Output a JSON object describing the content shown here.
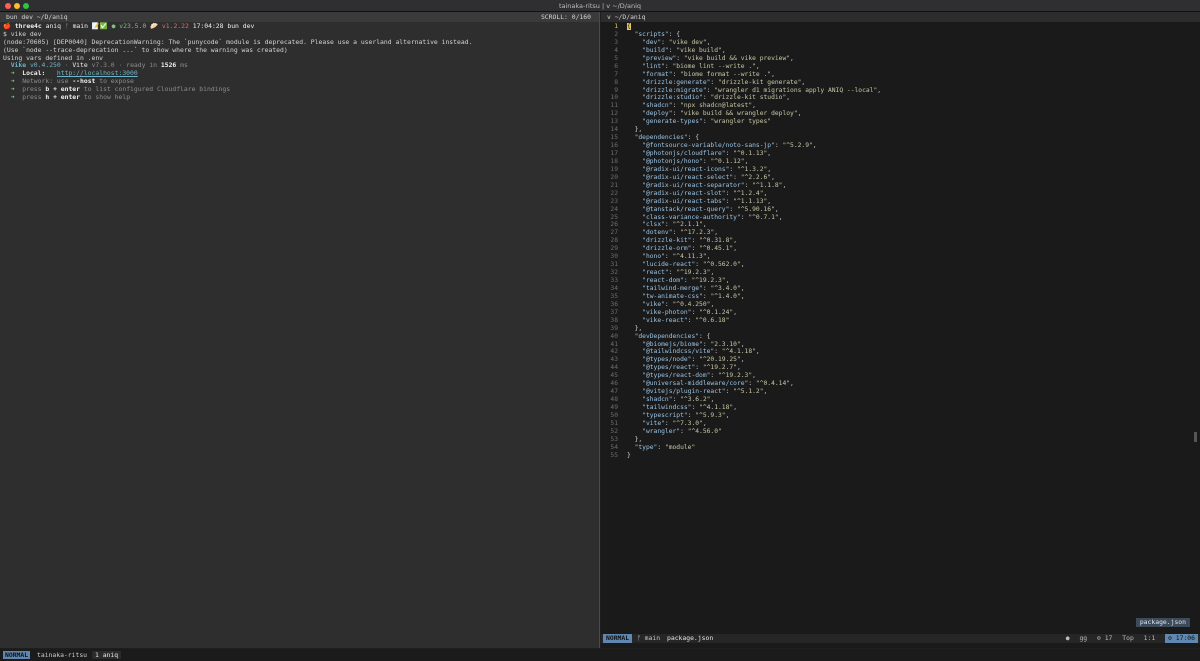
{
  "window": {
    "title": "tainaka-ritsu | v ~/D/aniq"
  },
  "left_pane": {
    "header_title": "bun dev ~/D/aniq",
    "scroll_label": "SCROLL:",
    "scroll_value": "0/160",
    "prompt": {
      "user": "three4c",
      "dir": "aniq",
      "branch": "main",
      "status_marks": "📝✅",
      "node_version": "● v23.5.0",
      "bun_version": "v1.2.22",
      "time": "17:04:28",
      "command": "bun dev"
    },
    "lines": [
      "$ vike dev",
      "(node:70605) [DEP0040] DeprecationWarning: The `punycode` module is deprecated. Please use a userland alternative instead.",
      "(Use `node --trace-deprecation ...` to show where the warning was created)",
      "Using vars defined in .env"
    ],
    "vike": {
      "name": "Vike",
      "version": "v0.4.250",
      "sep": "·",
      "vite": "Vite",
      "vite_version": "v7.3.0",
      "ready_text": "ready in",
      "ready_ms": "1526",
      "ready_unit": "ms"
    },
    "local_label": "Local:",
    "local_url": "http://localhost:3000",
    "network_label": "Network:",
    "network_text1": "use",
    "network_flag": "--host",
    "network_text2": "to expose",
    "hint1_pre": "press",
    "hint1_key": "b + enter",
    "hint1_post": "to list configured Cloudflare bindings",
    "hint2_pre": "press",
    "hint2_key": "h + enter",
    "hint2_post": "to show help"
  },
  "right_pane": {
    "header_title": "v ~/D/aniq",
    "file_badge": "package.json",
    "code_lines": [
      [
        [
          "cursor",
          "{"
        ]
      ],
      [
        [
          "p",
          "  "
        ],
        [
          "k",
          "\"scripts\""
        ],
        [
          "p",
          ": {"
        ]
      ],
      [
        [
          "p",
          "    "
        ],
        [
          "k",
          "\"dev\""
        ],
        [
          "p",
          ": "
        ],
        [
          "s",
          "\"vike dev\""
        ],
        [
          "p",
          ","
        ]
      ],
      [
        [
          "p",
          "    "
        ],
        [
          "k",
          "\"build\""
        ],
        [
          "p",
          ": "
        ],
        [
          "s",
          "\"vike build\""
        ],
        [
          "p",
          ","
        ]
      ],
      [
        [
          "p",
          "    "
        ],
        [
          "k",
          "\"preview\""
        ],
        [
          "p",
          ": "
        ],
        [
          "s",
          "\"vike build && vike preview\""
        ],
        [
          "p",
          ","
        ]
      ],
      [
        [
          "p",
          "    "
        ],
        [
          "k",
          "\"lint\""
        ],
        [
          "p",
          ": "
        ],
        [
          "s",
          "\"biome lint --write .\""
        ],
        [
          "p",
          ","
        ]
      ],
      [
        [
          "p",
          "    "
        ],
        [
          "k",
          "\"format\""
        ],
        [
          "p",
          ": "
        ],
        [
          "s",
          "\"biome format --write .\""
        ],
        [
          "p",
          ","
        ]
      ],
      [
        [
          "p",
          "    "
        ],
        [
          "k",
          "\"drizzle:generate\""
        ],
        [
          "p",
          ": "
        ],
        [
          "s",
          "\"drizzle-kit generate\""
        ],
        [
          "p",
          ","
        ]
      ],
      [
        [
          "p",
          "    "
        ],
        [
          "k",
          "\"drizzle:migrate\""
        ],
        [
          "p",
          ": "
        ],
        [
          "s",
          "\"wrangler d1 migrations apply ANIQ --local\""
        ],
        [
          "p",
          ","
        ]
      ],
      [
        [
          "p",
          "    "
        ],
        [
          "k",
          "\"drizzle:studio\""
        ],
        [
          "p",
          ": "
        ],
        [
          "s",
          "\"drizzle-kit studio\""
        ],
        [
          "p",
          ","
        ]
      ],
      [
        [
          "p",
          "    "
        ],
        [
          "k",
          "\"shadcn\""
        ],
        [
          "p",
          ": "
        ],
        [
          "s",
          "\"npx shadcn@latest\""
        ],
        [
          "p",
          ","
        ]
      ],
      [
        [
          "p",
          "    "
        ],
        [
          "k",
          "\"deploy\""
        ],
        [
          "p",
          ": "
        ],
        [
          "s",
          "\"vike build && wrangler deploy\""
        ],
        [
          "p",
          ","
        ]
      ],
      [
        [
          "p",
          "    "
        ],
        [
          "k",
          "\"generate-types\""
        ],
        [
          "p",
          ": "
        ],
        [
          "s",
          "\"wrangler types\""
        ]
      ],
      [
        [
          "p",
          "  },"
        ]
      ],
      [
        [
          "p",
          "  "
        ],
        [
          "k",
          "\"dependencies\""
        ],
        [
          "p",
          ": {"
        ]
      ],
      [
        [
          "p",
          "    "
        ],
        [
          "k",
          "\"@fontsource-variable/noto-sans-jp\""
        ],
        [
          "p",
          ": "
        ],
        [
          "s",
          "\"^5.2.9\""
        ],
        [
          "p",
          ","
        ]
      ],
      [
        [
          "p",
          "    "
        ],
        [
          "k",
          "\"@photonjs/cloudflare\""
        ],
        [
          "p",
          ": "
        ],
        [
          "s",
          "\"^0.1.13\""
        ],
        [
          "p",
          ","
        ]
      ],
      [
        [
          "p",
          "    "
        ],
        [
          "k",
          "\"@photonjs/hono\""
        ],
        [
          "p",
          ": "
        ],
        [
          "s",
          "\"^0.1.12\""
        ],
        [
          "p",
          ","
        ]
      ],
      [
        [
          "p",
          "    "
        ],
        [
          "k",
          "\"@radix-ui/react-icons\""
        ],
        [
          "p",
          ": "
        ],
        [
          "s",
          "\"^1.3.2\""
        ],
        [
          "p",
          ","
        ]
      ],
      [
        [
          "p",
          "    "
        ],
        [
          "k",
          "\"@radix-ui/react-select\""
        ],
        [
          "p",
          ": "
        ],
        [
          "s",
          "\"^2.2.6\""
        ],
        [
          "p",
          ","
        ]
      ],
      [
        [
          "p",
          "    "
        ],
        [
          "k",
          "\"@radix-ui/react-separator\""
        ],
        [
          "p",
          ": "
        ],
        [
          "s",
          "\"^1.1.8\""
        ],
        [
          "p",
          ","
        ]
      ],
      [
        [
          "p",
          "    "
        ],
        [
          "k",
          "\"@radix-ui/react-slot\""
        ],
        [
          "p",
          ": "
        ],
        [
          "s",
          "\"^1.2.4\""
        ],
        [
          "p",
          ","
        ]
      ],
      [
        [
          "p",
          "    "
        ],
        [
          "k",
          "\"@radix-ui/react-tabs\""
        ],
        [
          "p",
          ": "
        ],
        [
          "s",
          "\"^1.1.13\""
        ],
        [
          "p",
          ","
        ]
      ],
      [
        [
          "p",
          "    "
        ],
        [
          "k",
          "\"@tanstack/react-query\""
        ],
        [
          "p",
          ": "
        ],
        [
          "s",
          "\"^5.90.16\""
        ],
        [
          "p",
          ","
        ]
      ],
      [
        [
          "p",
          "    "
        ],
        [
          "k",
          "\"class-variance-authority\""
        ],
        [
          "p",
          ": "
        ],
        [
          "s",
          "\"^0.7.1\""
        ],
        [
          "p",
          ","
        ]
      ],
      [
        [
          "p",
          "    "
        ],
        [
          "k",
          "\"clsx\""
        ],
        [
          "p",
          ": "
        ],
        [
          "s",
          "\"^2.1.1\""
        ],
        [
          "p",
          ","
        ]
      ],
      [
        [
          "p",
          "    "
        ],
        [
          "k",
          "\"dotenv\""
        ],
        [
          "p",
          ": "
        ],
        [
          "s",
          "\"^17.2.3\""
        ],
        [
          "p",
          ","
        ]
      ],
      [
        [
          "p",
          "    "
        ],
        [
          "k",
          "\"drizzle-kit\""
        ],
        [
          "p",
          ": "
        ],
        [
          "s",
          "\"^0.31.8\""
        ],
        [
          "p",
          ","
        ]
      ],
      [
        [
          "p",
          "    "
        ],
        [
          "k",
          "\"drizzle-orm\""
        ],
        [
          "p",
          ": "
        ],
        [
          "s",
          "\"^0.45.1\""
        ],
        [
          "p",
          ","
        ]
      ],
      [
        [
          "p",
          "    "
        ],
        [
          "k",
          "\"hono\""
        ],
        [
          "p",
          ": "
        ],
        [
          "s",
          "\"^4.11.3\""
        ],
        [
          "p",
          ","
        ]
      ],
      [
        [
          "p",
          "    "
        ],
        [
          "k",
          "\"lucide-react\""
        ],
        [
          "p",
          ": "
        ],
        [
          "s",
          "\"^0.562.0\""
        ],
        [
          "p",
          ","
        ]
      ],
      [
        [
          "p",
          "    "
        ],
        [
          "k",
          "\"react\""
        ],
        [
          "p",
          ": "
        ],
        [
          "s",
          "\"^19.2.3\""
        ],
        [
          "p",
          ","
        ]
      ],
      [
        [
          "p",
          "    "
        ],
        [
          "k",
          "\"react-dom\""
        ],
        [
          "p",
          ": "
        ],
        [
          "s",
          "\"^19.2.3\""
        ],
        [
          "p",
          ","
        ]
      ],
      [
        [
          "p",
          "    "
        ],
        [
          "k",
          "\"tailwind-merge\""
        ],
        [
          "p",
          ": "
        ],
        [
          "s",
          "\"^3.4.0\""
        ],
        [
          "p",
          ","
        ]
      ],
      [
        [
          "p",
          "    "
        ],
        [
          "k",
          "\"tw-animate-css\""
        ],
        [
          "p",
          ": "
        ],
        [
          "s",
          "\"^1.4.0\""
        ],
        [
          "p",
          ","
        ]
      ],
      [
        [
          "p",
          "    "
        ],
        [
          "k",
          "\"vike\""
        ],
        [
          "p",
          ": "
        ],
        [
          "s",
          "\"^0.4.250\""
        ],
        [
          "p",
          ","
        ]
      ],
      [
        [
          "p",
          "    "
        ],
        [
          "k",
          "\"vike-photon\""
        ],
        [
          "p",
          ": "
        ],
        [
          "s",
          "\"^0.1.24\""
        ],
        [
          "p",
          ","
        ]
      ],
      [
        [
          "p",
          "    "
        ],
        [
          "k",
          "\"vike-react\""
        ],
        [
          "p",
          ": "
        ],
        [
          "s",
          "\"^0.6.18\""
        ]
      ],
      [
        [
          "p",
          "  },"
        ]
      ],
      [
        [
          "p",
          "  "
        ],
        [
          "k",
          "\"devDependencies\""
        ],
        [
          "p",
          ": {"
        ]
      ],
      [
        [
          "p",
          "    "
        ],
        [
          "k",
          "\"@biomejs/biome\""
        ],
        [
          "p",
          ": "
        ],
        [
          "s",
          "\"2.3.10\""
        ],
        [
          "p",
          ","
        ]
      ],
      [
        [
          "p",
          "    "
        ],
        [
          "k",
          "\"@tailwindcss/vite\""
        ],
        [
          "p",
          ": "
        ],
        [
          "s",
          "\"^4.1.18\""
        ],
        [
          "p",
          ","
        ]
      ],
      [
        [
          "p",
          "    "
        ],
        [
          "k",
          "\"@types/node\""
        ],
        [
          "p",
          ": "
        ],
        [
          "s",
          "\"^20.19.25\""
        ],
        [
          "p",
          ","
        ]
      ],
      [
        [
          "p",
          "    "
        ],
        [
          "k",
          "\"@types/react\""
        ],
        [
          "p",
          ": "
        ],
        [
          "s",
          "\"^19.2.7\""
        ],
        [
          "p",
          ","
        ]
      ],
      [
        [
          "p",
          "    "
        ],
        [
          "k",
          "\"@types/react-dom\""
        ],
        [
          "p",
          ": "
        ],
        [
          "s",
          "\"^19.2.3\""
        ],
        [
          "p",
          ","
        ]
      ],
      [
        [
          "p",
          "    "
        ],
        [
          "k",
          "\"@universal-middleware/core\""
        ],
        [
          "p",
          ": "
        ],
        [
          "s",
          "\"^0.4.14\""
        ],
        [
          "p",
          ","
        ]
      ],
      [
        [
          "p",
          "    "
        ],
        [
          "k",
          "\"@vitejs/plugin-react\""
        ],
        [
          "p",
          ": "
        ],
        [
          "s",
          "\"^5.1.2\""
        ],
        [
          "p",
          ","
        ]
      ],
      [
        [
          "p",
          "    "
        ],
        [
          "k",
          "\"shadcn\""
        ],
        [
          "p",
          ": "
        ],
        [
          "s",
          "\"^3.6.2\""
        ],
        [
          "p",
          ","
        ]
      ],
      [
        [
          "p",
          "    "
        ],
        [
          "k",
          "\"tailwindcss\""
        ],
        [
          "p",
          ": "
        ],
        [
          "s",
          "\"^4.1.18\""
        ],
        [
          "p",
          ","
        ]
      ],
      [
        [
          "p",
          "    "
        ],
        [
          "k",
          "\"typescript\""
        ],
        [
          "p",
          ": "
        ],
        [
          "s",
          "\"^5.9.3\""
        ],
        [
          "p",
          ","
        ]
      ],
      [
        [
          "p",
          "    "
        ],
        [
          "k",
          "\"vite\""
        ],
        [
          "p",
          ": "
        ],
        [
          "s",
          "\"^7.3.0\""
        ],
        [
          "p",
          ","
        ]
      ],
      [
        [
          "p",
          "    "
        ],
        [
          "k",
          "\"wrangler\""
        ],
        [
          "p",
          ": "
        ],
        [
          "s",
          "\"^4.56.0\""
        ]
      ],
      [
        [
          "p",
          "  },"
        ]
      ],
      [
        [
          "p",
          "  "
        ],
        [
          "k",
          "\"type\""
        ],
        [
          "p",
          ": "
        ],
        [
          "s",
          "\"module\""
        ]
      ],
      [
        [
          "p",
          "}"
        ]
      ]
    ],
    "statusline": {
      "mode": "NORMAL",
      "branch": "ᚠ main",
      "file": "package.json",
      "dot": "●",
      "gg": "gg",
      "count": "⊙ 17",
      "pos": "Top",
      "cursor": "1:1",
      "clock": "⊙ 17:06"
    }
  },
  "tmux": {
    "mode": "NORMAL",
    "host": "tainaka-ritsu",
    "window": "1 aniq"
  }
}
